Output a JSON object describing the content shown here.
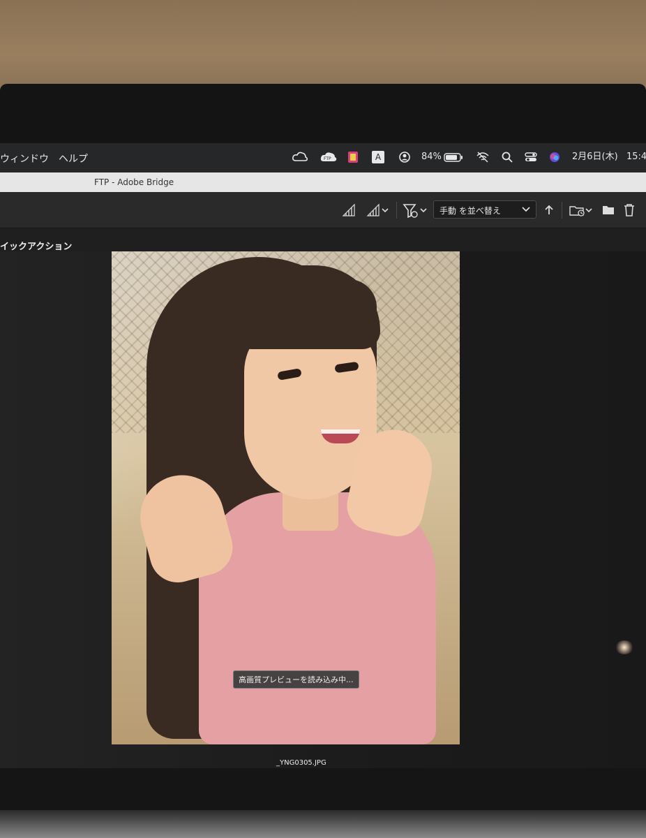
{
  "menubar": {
    "items": [
      "ウィンドウ",
      "ヘルプ"
    ],
    "tray": {
      "creative_cloud_icon": "creative-cloud-icon",
      "ftp_label": "FTP",
      "input_source": "A",
      "battery": "84%",
      "date": "2月6日(木)",
      "time": "15:4"
    }
  },
  "window": {
    "title": "FTP - Adobe Bridge"
  },
  "toolbar": {
    "sort_label": "手動 を並べ替え"
  },
  "panel": {
    "header": "イックアクション"
  },
  "preview": {
    "loading_text": "高画質プレビューを読み込み中...",
    "filename": "_YNG0305.JPG"
  },
  "colors": {
    "accent": "#2a2a2a",
    "titlebar": "#e6e6e6"
  }
}
